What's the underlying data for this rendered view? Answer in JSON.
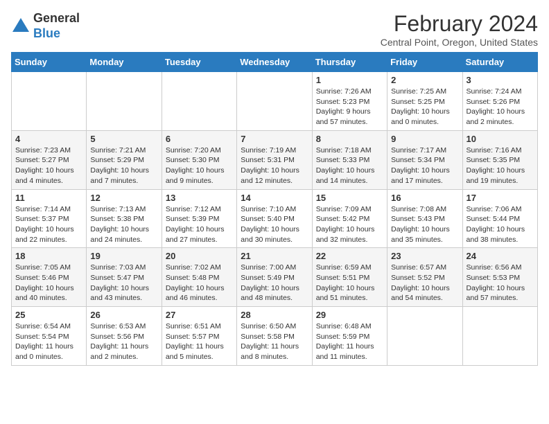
{
  "logo": {
    "general": "General",
    "blue": "Blue"
  },
  "header": {
    "month_year": "February 2024",
    "location": "Central Point, Oregon, United States"
  },
  "days_of_week": [
    "Sunday",
    "Monday",
    "Tuesday",
    "Wednesday",
    "Thursday",
    "Friday",
    "Saturday"
  ],
  "weeks": [
    [
      {
        "day": null,
        "data": null
      },
      {
        "day": null,
        "data": null
      },
      {
        "day": null,
        "data": null
      },
      {
        "day": null,
        "data": null
      },
      {
        "day": "1",
        "data": "Sunrise: 7:26 AM\nSunset: 5:23 PM\nDaylight: 9 hours and 57 minutes."
      },
      {
        "day": "2",
        "data": "Sunrise: 7:25 AM\nSunset: 5:25 PM\nDaylight: 10 hours and 0 minutes."
      },
      {
        "day": "3",
        "data": "Sunrise: 7:24 AM\nSunset: 5:26 PM\nDaylight: 10 hours and 2 minutes."
      }
    ],
    [
      {
        "day": "4",
        "data": "Sunrise: 7:23 AM\nSunset: 5:27 PM\nDaylight: 10 hours and 4 minutes."
      },
      {
        "day": "5",
        "data": "Sunrise: 7:21 AM\nSunset: 5:29 PM\nDaylight: 10 hours and 7 minutes."
      },
      {
        "day": "6",
        "data": "Sunrise: 7:20 AM\nSunset: 5:30 PM\nDaylight: 10 hours and 9 minutes."
      },
      {
        "day": "7",
        "data": "Sunrise: 7:19 AM\nSunset: 5:31 PM\nDaylight: 10 hours and 12 minutes."
      },
      {
        "day": "8",
        "data": "Sunrise: 7:18 AM\nSunset: 5:33 PM\nDaylight: 10 hours and 14 minutes."
      },
      {
        "day": "9",
        "data": "Sunrise: 7:17 AM\nSunset: 5:34 PM\nDaylight: 10 hours and 17 minutes."
      },
      {
        "day": "10",
        "data": "Sunrise: 7:16 AM\nSunset: 5:35 PM\nDaylight: 10 hours and 19 minutes."
      }
    ],
    [
      {
        "day": "11",
        "data": "Sunrise: 7:14 AM\nSunset: 5:37 PM\nDaylight: 10 hours and 22 minutes."
      },
      {
        "day": "12",
        "data": "Sunrise: 7:13 AM\nSunset: 5:38 PM\nDaylight: 10 hours and 24 minutes."
      },
      {
        "day": "13",
        "data": "Sunrise: 7:12 AM\nSunset: 5:39 PM\nDaylight: 10 hours and 27 minutes."
      },
      {
        "day": "14",
        "data": "Sunrise: 7:10 AM\nSunset: 5:40 PM\nDaylight: 10 hours and 30 minutes."
      },
      {
        "day": "15",
        "data": "Sunrise: 7:09 AM\nSunset: 5:42 PM\nDaylight: 10 hours and 32 minutes."
      },
      {
        "day": "16",
        "data": "Sunrise: 7:08 AM\nSunset: 5:43 PM\nDaylight: 10 hours and 35 minutes."
      },
      {
        "day": "17",
        "data": "Sunrise: 7:06 AM\nSunset: 5:44 PM\nDaylight: 10 hours and 38 minutes."
      }
    ],
    [
      {
        "day": "18",
        "data": "Sunrise: 7:05 AM\nSunset: 5:46 PM\nDaylight: 10 hours and 40 minutes."
      },
      {
        "day": "19",
        "data": "Sunrise: 7:03 AM\nSunset: 5:47 PM\nDaylight: 10 hours and 43 minutes."
      },
      {
        "day": "20",
        "data": "Sunrise: 7:02 AM\nSunset: 5:48 PM\nDaylight: 10 hours and 46 minutes."
      },
      {
        "day": "21",
        "data": "Sunrise: 7:00 AM\nSunset: 5:49 PM\nDaylight: 10 hours and 48 minutes."
      },
      {
        "day": "22",
        "data": "Sunrise: 6:59 AM\nSunset: 5:51 PM\nDaylight: 10 hours and 51 minutes."
      },
      {
        "day": "23",
        "data": "Sunrise: 6:57 AM\nSunset: 5:52 PM\nDaylight: 10 hours and 54 minutes."
      },
      {
        "day": "24",
        "data": "Sunrise: 6:56 AM\nSunset: 5:53 PM\nDaylight: 10 hours and 57 minutes."
      }
    ],
    [
      {
        "day": "25",
        "data": "Sunrise: 6:54 AM\nSunset: 5:54 PM\nDaylight: 11 hours and 0 minutes."
      },
      {
        "day": "26",
        "data": "Sunrise: 6:53 AM\nSunset: 5:56 PM\nDaylight: 11 hours and 2 minutes."
      },
      {
        "day": "27",
        "data": "Sunrise: 6:51 AM\nSunset: 5:57 PM\nDaylight: 11 hours and 5 minutes."
      },
      {
        "day": "28",
        "data": "Sunrise: 6:50 AM\nSunset: 5:58 PM\nDaylight: 11 hours and 8 minutes."
      },
      {
        "day": "29",
        "data": "Sunrise: 6:48 AM\nSunset: 5:59 PM\nDaylight: 11 hours and 11 minutes."
      },
      {
        "day": null,
        "data": null
      },
      {
        "day": null,
        "data": null
      }
    ]
  ]
}
